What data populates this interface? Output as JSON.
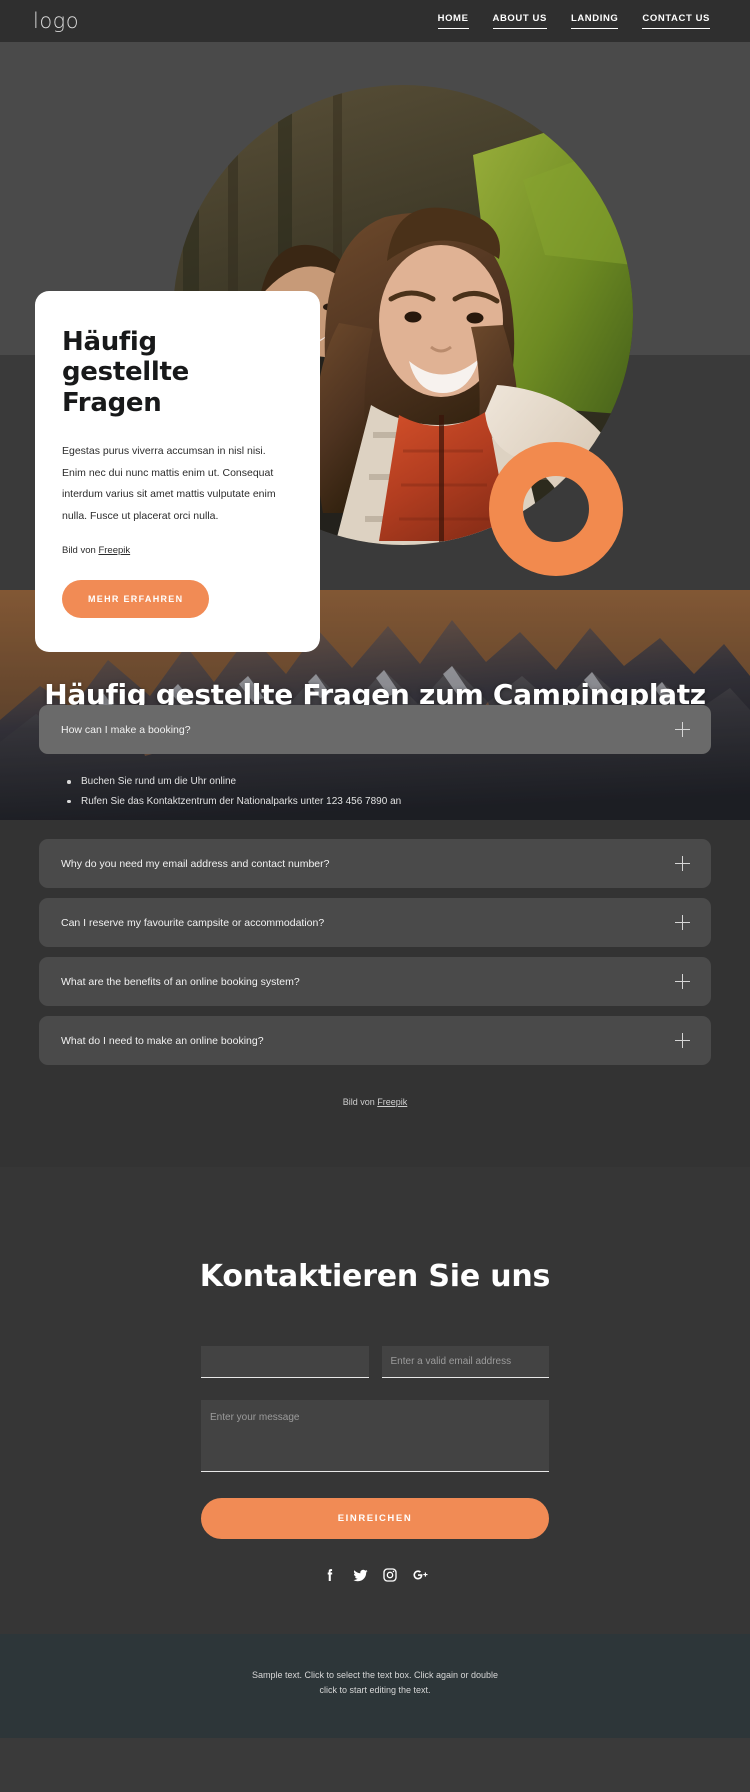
{
  "header": {
    "logo": "logo",
    "nav": [
      {
        "label": "HOME"
      },
      {
        "label": "ABOUT US"
      },
      {
        "label": "LANDING"
      },
      {
        "label": "CONTACT US"
      }
    ]
  },
  "hero": {
    "card": {
      "title": "Häufig gestellte Fragen",
      "body": "Egestas purus viverra accumsan in nisl nisi. Enim nec dui nunc mattis enim ut. Consequat interdum varius sit amet mattis vulputate enim nulla. Fusce ut placerat orci nulla.",
      "credit_prefix": "Bild von ",
      "credit_link": "Freepik",
      "button": "MEHR ERFAHREN"
    },
    "photo_alt": "campers-selfie-photo",
    "ring_color": "#f28a4e"
  },
  "faq": {
    "heading": "Häufig gestellte Fragen zum Campingplatz",
    "banner_alt": "mountain-range-photo",
    "items": [
      {
        "question": "How can I make a booking?",
        "open": true,
        "answers": [
          "Buchen Sie rund um die Uhr online",
          "Rufen Sie das Kontaktzentrum der Nationalparks unter 123 456 7890 an"
        ]
      },
      {
        "question": "Why do you need my email address and contact number?",
        "open": false,
        "answers": []
      },
      {
        "question": "Can I reserve my favourite campsite or accommodation?",
        "open": false,
        "answers": []
      },
      {
        "question": "What are the benefits of an online booking system?",
        "open": false,
        "answers": []
      },
      {
        "question": "What do I need to make an online booking?",
        "open": false,
        "answers": []
      }
    ],
    "credit_prefix": "Bild von ",
    "credit_link": "Freepik"
  },
  "contact": {
    "title": "Kontaktieren Sie uns",
    "name_value": "",
    "name_placeholder": "",
    "email_value": "",
    "email_placeholder": "Enter a valid email address",
    "message_value": "",
    "message_placeholder": "Enter your message",
    "submit": "EINREICHEN",
    "socials": [
      {
        "name": "facebook"
      },
      {
        "name": "twitter"
      },
      {
        "name": "instagram"
      },
      {
        "name": "google-plus"
      }
    ]
  },
  "footer": {
    "text": "Sample text. Click to select the text box. Click again or double click to start editing the text."
  },
  "colors": {
    "accent": "#f18b55",
    "page_bg": "#3a3a3a",
    "card_bg": "#ffffff",
    "accordion_bg": "#4a4a4a",
    "accordion_open_bg": "#6a6a6a",
    "footer_bg": "#2d3639"
  }
}
